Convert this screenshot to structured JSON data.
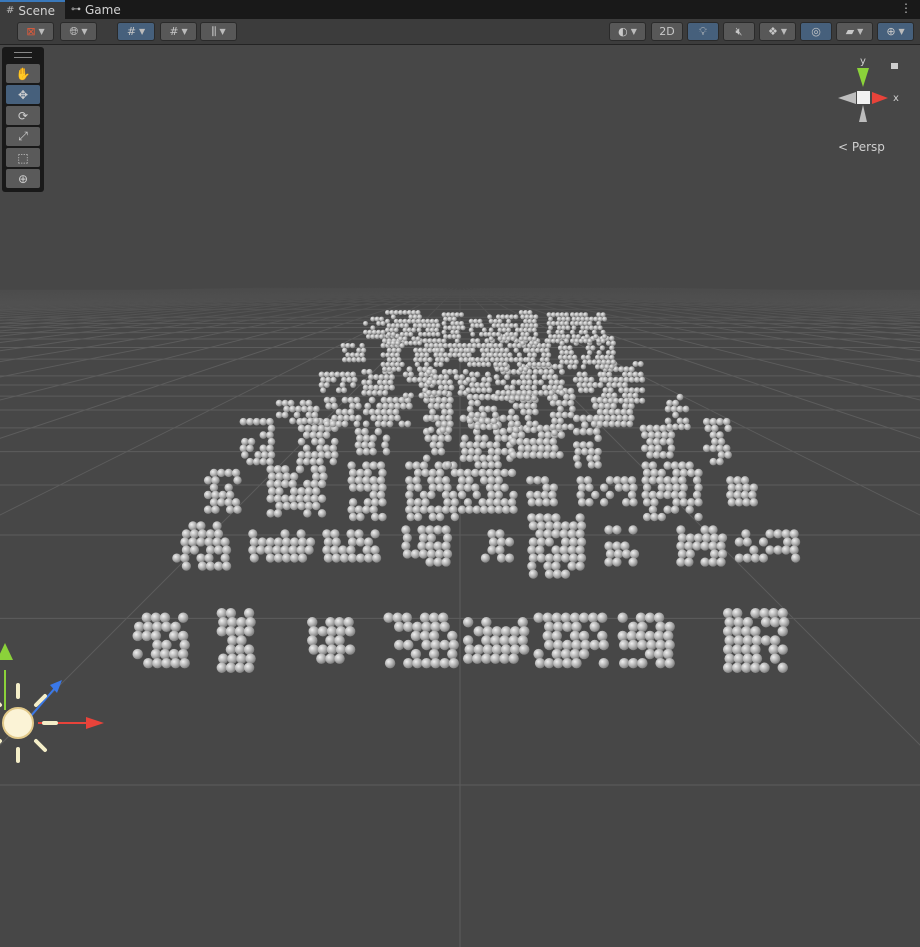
{
  "tabs": [
    {
      "label": "Scene",
      "icon": "grid-icon",
      "active": true
    },
    {
      "label": "Game",
      "icon": "gamepad-icon",
      "active": false
    }
  ],
  "toolbar": {
    "mode_2d_label": "2D",
    "buttons": [
      "draw-mode",
      "global-local",
      "grid-snap",
      "increment-snap",
      "ruler",
      "shading",
      "2d-toggle",
      "lighting",
      "audio",
      "effects",
      "hidden-objects",
      "camera",
      "gizmos"
    ]
  },
  "tools": [
    {
      "name": "hand-tool",
      "icon": "hand-icon",
      "glyph": "✋",
      "selected": false
    },
    {
      "name": "move-tool",
      "icon": "move-icon",
      "glyph": "✥",
      "selected": true
    },
    {
      "name": "rotate-tool",
      "icon": "rotate-icon",
      "glyph": "⟳",
      "selected": false
    },
    {
      "name": "scale-tool",
      "icon": "scale-icon",
      "glyph": "⤢",
      "selected": false
    },
    {
      "name": "rect-tool",
      "icon": "rect-icon",
      "glyph": "⬚",
      "selected": false
    },
    {
      "name": "transform-tool",
      "icon": "transform-icon",
      "glyph": "⊕",
      "selected": false
    }
  ],
  "gizmo": {
    "x_label": "x",
    "y_label": "y",
    "projection_label": "Persp"
  },
  "colors": {
    "accent": "#46607c",
    "background": "#474747",
    "axis_x": "#e8433a",
    "axis_y": "#8bd23a",
    "axis_z": "#3a78e8"
  }
}
